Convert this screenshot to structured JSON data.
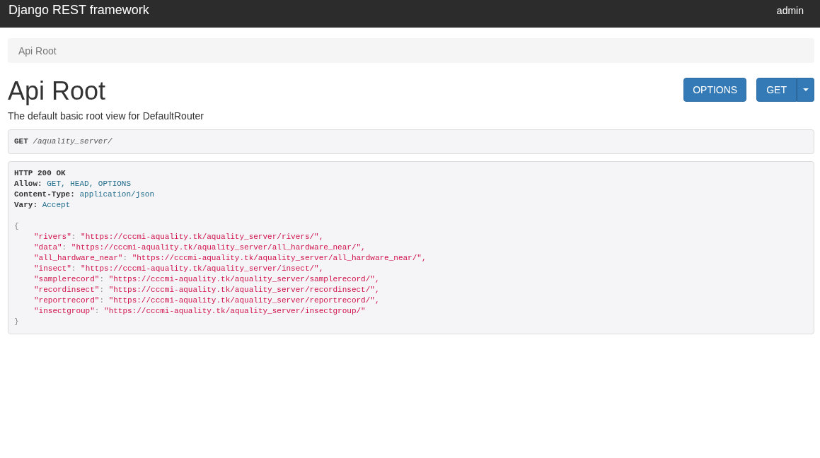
{
  "navbar": {
    "brand": "Django REST framework",
    "user": "admin"
  },
  "breadcrumb": [
    {
      "label": "Api Root",
      "selected": true
    }
  ],
  "page": {
    "title": "Api Root",
    "description": "The default basic root view for DefaultRouter"
  },
  "buttons": [
    {
      "kind": "plain",
      "label": "OPTIONS"
    },
    {
      "kind": "split",
      "label": "GET"
    }
  ],
  "request": {
    "method": "GET",
    "path": "/aquality_server/"
  },
  "response": {
    "status": "HTTP 200 OK",
    "headers": [
      {
        "name": "Allow:",
        "value": "GET, HEAD, OPTIONS"
      },
      {
        "name": "Content-Type:",
        "value": "application/json"
      },
      {
        "name": "Vary:",
        "value": "Accept"
      }
    ],
    "open": "{",
    "entries": [
      {
        "key": "\"rivers\"",
        "sep": ":",
        "value": "\"https://cccmi-aquality.tk/aquality_server/rivers/\","
      },
      {
        "key": "\"data\"",
        "sep": ":",
        "value": "\"https://cccmi-aquality.tk/aquality_server/all_hardware_near/\","
      },
      {
        "key": "\"all_hardware_near\"",
        "sep": ":",
        "value": "\"https://cccmi-aquality.tk/aquality_server/all_hardware_near/\","
      },
      {
        "key": "\"insect\"",
        "sep": ":",
        "value": "\"https://cccmi-aquality.tk/aquality_server/insect/\","
      },
      {
        "key": "\"samplerecord\"",
        "sep": ":",
        "value": "\"https://cccmi-aquality.tk/aquality_server/samplerecord/\","
      },
      {
        "key": "\"recordinsect\"",
        "sep": ":",
        "value": "\"https://cccmi-aquality.tk/aquality_server/recordinsect/\","
      },
      {
        "key": "\"reportrecord\"",
        "sep": ":",
        "value": "\"https://cccmi-aquality.tk/aquality_server/reportrecord/\","
      },
      {
        "key": "\"insectgroup\"",
        "sep": ":",
        "value": "\"https://cccmi-aquality.tk/aquality_server/insectgroup/\""
      }
    ],
    "close": "}"
  }
}
